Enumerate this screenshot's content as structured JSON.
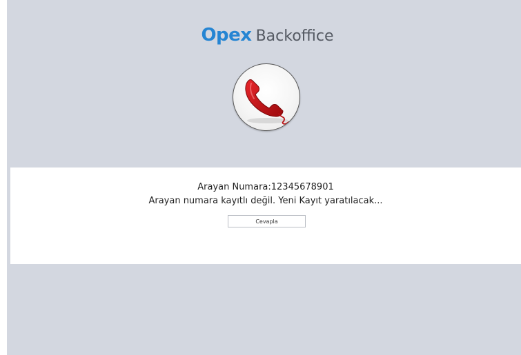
{
  "header": {
    "brand": "Opex",
    "product": "Backoffice"
  },
  "icons": {
    "phone": "phone-handset-icon"
  },
  "colors": {
    "brand_blue": "#2585d3",
    "background": "#d3d7e0",
    "phone_red": "#c40f13"
  },
  "call": {
    "caller_label": "Arayan Numara:12345678901",
    "message": "Arayan numara kayıtlı değil. Yeni Kayıt yaratılacak...",
    "answer_label": "Cevapla"
  }
}
